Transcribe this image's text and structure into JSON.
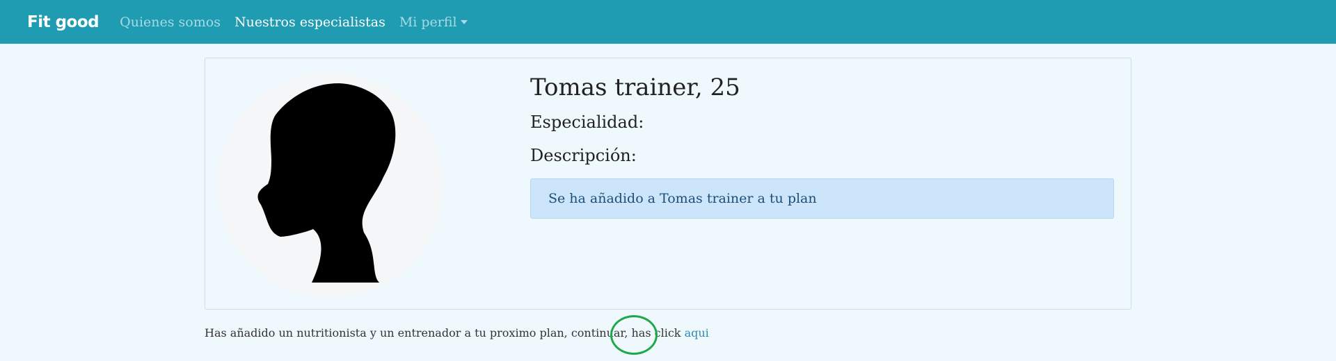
{
  "navbar": {
    "brand": "Fit good",
    "links": [
      {
        "label": "Quienes somos"
      },
      {
        "label": "Nuestros especialistas"
      },
      {
        "label": "Mi perfil"
      }
    ]
  },
  "profile": {
    "title": "Tomas trainer, 25",
    "specialty_label": "Especialidad:",
    "description_label": "Descripción:",
    "alert_message": "Se ha añadido a Tomas trainer a tu plan"
  },
  "footer": {
    "message": "Has añadido un nutritionista y un entrenador a tu proximo plan, continuar, has click ",
    "link_label": "aqui"
  },
  "colors": {
    "navbar": "#1f9bb2",
    "background": "#eff8fd",
    "alert_background": "#cce5fb",
    "highlight": "#1fa84a"
  },
  "icons": {
    "avatar": "head-silhouette-icon",
    "dropdown": "caret-down-icon"
  }
}
